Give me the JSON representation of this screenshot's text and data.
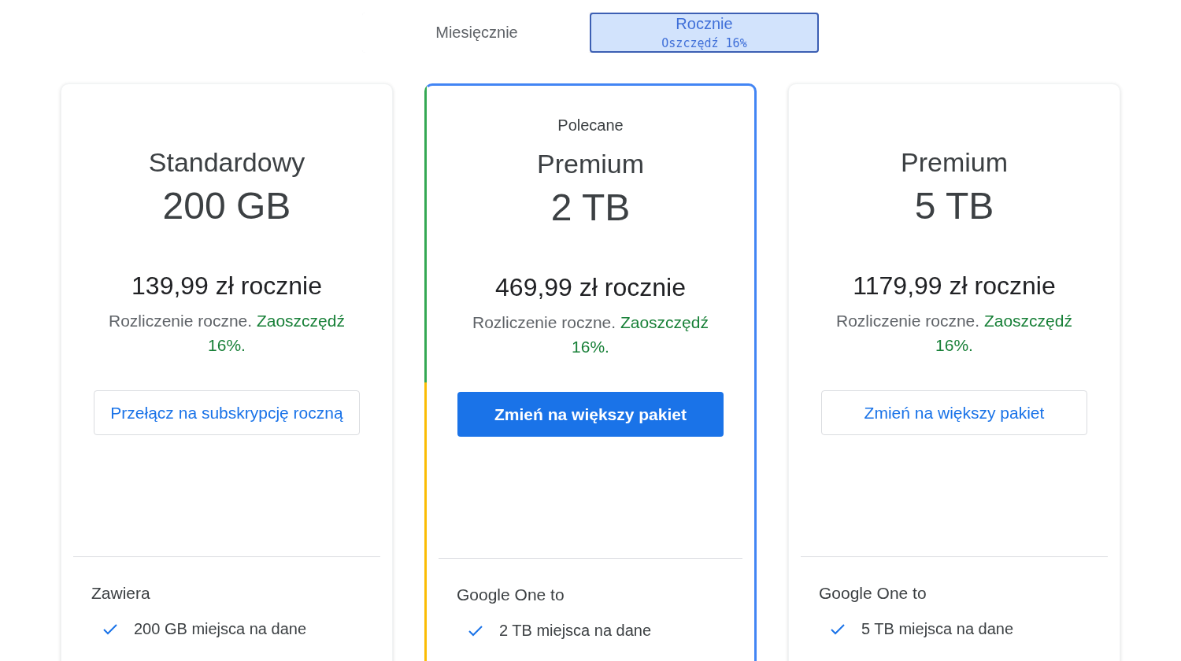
{
  "billing_toggle": [
    {
      "label": "Miesięcznie",
      "selected": false
    },
    {
      "label": "Rocznie",
      "sublabel": "Oszczędź 16%",
      "selected": true
    }
  ],
  "plans": [
    {
      "featured": false,
      "name": "Standardowy",
      "size": "200 GB",
      "price": "139,99 zł rocznie",
      "billing_note": "Rozliczenie roczne.",
      "savings": "Zaoszczędź 16%.",
      "button": {
        "label": "Przełącz na subskrypcję roczną",
        "kind": "outlined"
      },
      "section_heading": "Zawiera",
      "features": [
        "200 GB miejsca na dane"
      ]
    },
    {
      "featured": true,
      "badge": "Polecane",
      "name": "Premium",
      "size": "2 TB",
      "price": "469,99 zł rocznie",
      "billing_note": "Rozliczenie roczne.",
      "savings": "Zaoszczędź 16%.",
      "button": {
        "label": "Zmień na większy pakiet",
        "kind": "filled"
      },
      "section_heading": "Google One to",
      "features": [
        "2 TB miejsca na dane"
      ]
    },
    {
      "featured": false,
      "name": "Premium",
      "size": "5 TB",
      "price": "1179,99 zł rocznie",
      "billing_note": "Rozliczenie roczne.",
      "savings": "Zaoszczędź 16%.",
      "button": {
        "label": "Zmień na większy pakiet",
        "kind": "outlined"
      },
      "section_heading": "Google One to",
      "features": [
        "5 TB miejsca na dane"
      ]
    }
  ]
}
